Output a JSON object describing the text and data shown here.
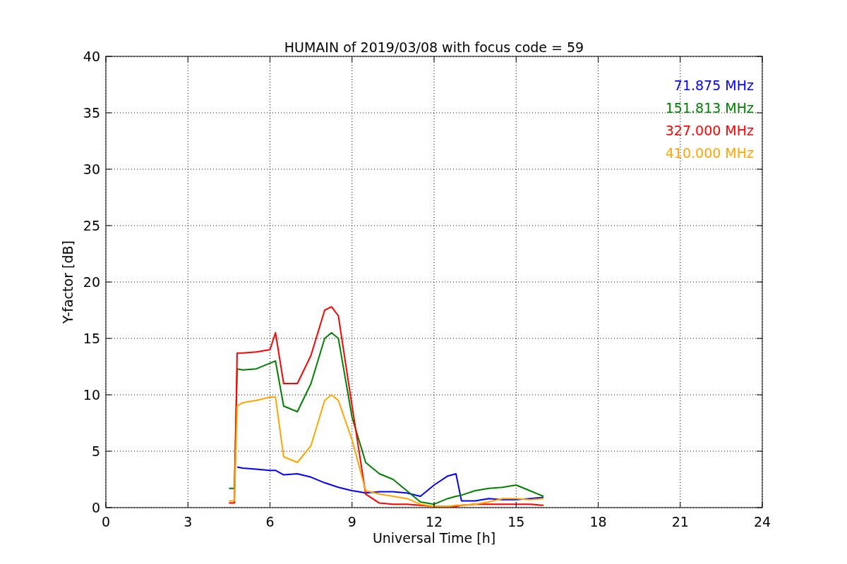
{
  "chart_data": {
    "type": "line",
    "title": "HUMAIN of 2019/03/08 with focus code = 59",
    "xlabel": "Universal Time [h]",
    "ylabel": "Y-factor [dB]",
    "x": [
      4.5,
      4.7,
      4.8,
      5,
      5.5,
      6,
      6.2,
      6.5,
      7,
      7.5,
      8,
      8.25,
      8.5,
      9,
      9.5,
      10,
      10.5,
      11,
      11.5,
      12,
      12.5,
      12.8,
      13,
      13.5,
      14,
      14.5,
      15,
      15.5,
      16
    ],
    "series": [
      {
        "name": "71.875 MHz",
        "color": "#0000ff",
        "values": [
          null,
          null,
          3.6,
          3.5,
          3.4,
          3.3,
          3.3,
          2.9,
          3.0,
          2.7,
          2.2,
          2.0,
          1.8,
          1.5,
          1.3,
          1.4,
          1.4,
          1.3,
          1.0,
          2.0,
          2.8,
          3.0,
          0.6,
          0.6,
          0.8,
          0.7,
          0.7,
          0.8,
          0.9
        ]
      },
      {
        "name": "151.813 MHz",
        "color": "#008000",
        "values": [
          1.7,
          1.7,
          12.3,
          12.2,
          12.3,
          12.8,
          13.0,
          9.0,
          8.5,
          11.0,
          15.0,
          15.5,
          15.0,
          8.0,
          4.0,
          3.0,
          2.5,
          1.5,
          0.5,
          0.3,
          0.8,
          1.0,
          1.1,
          1.5,
          1.7,
          1.8,
          2.0,
          1.5,
          1.0
        ]
      },
      {
        "name": "327.000 MHz",
        "color": "#ff0000",
        "values": [
          0.4,
          0.4,
          13.7,
          13.7,
          13.8,
          14.0,
          15.5,
          11.0,
          11.0,
          13.5,
          17.5,
          17.8,
          17.0,
          9.0,
          1.2,
          0.4,
          0.3,
          0.3,
          0.2,
          0.1,
          0.1,
          0.1,
          0.2,
          0.3,
          0.3,
          0.3,
          0.3,
          0.3,
          0.2
        ]
      },
      {
        "name": "410.000 MHz",
        "color": "#ffa500",
        "values": [
          0.6,
          0.6,
          9.0,
          9.3,
          9.5,
          9.8,
          9.8,
          4.5,
          4.0,
          5.5,
          9.5,
          10.0,
          9.5,
          6.0,
          1.5,
          1.2,
          1.0,
          0.8,
          0.3,
          0.1,
          0.1,
          0.2,
          0.2,
          0.3,
          0.5,
          0.8,
          0.8,
          0.7,
          0.8
        ]
      }
    ],
    "grid": true,
    "xlim": [
      0,
      24
    ],
    "ylim": [
      0,
      40
    ],
    "xticks": [
      0,
      3,
      6,
      9,
      12,
      15,
      18,
      21,
      24
    ],
    "yticks": [
      0,
      5,
      10,
      15,
      20,
      25,
      30,
      35,
      40
    ]
  }
}
